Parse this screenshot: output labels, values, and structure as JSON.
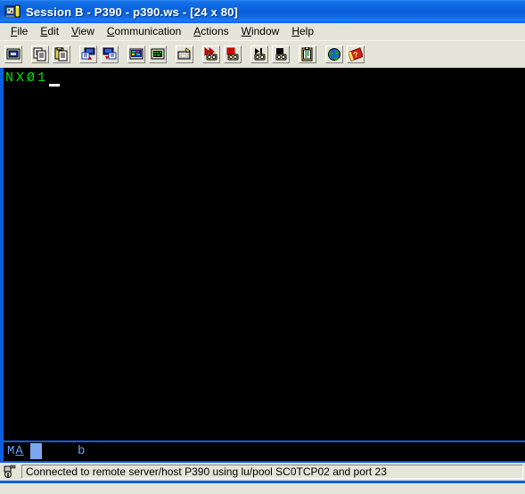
{
  "window": {
    "title": "Session B - P390 - p390.ws - [24 x 80]",
    "icon": "terminal-session-icon",
    "accent_color": "#0a5fe0",
    "titlebar_color": "#0b62dd",
    "chrome_color": "#e4e4d8"
  },
  "menubar": {
    "items": [
      {
        "label": "File",
        "mnemonic": "F"
      },
      {
        "label": "Edit",
        "mnemonic": "E"
      },
      {
        "label": "View",
        "mnemonic": "V"
      },
      {
        "label": "Communication",
        "mnemonic": "C"
      },
      {
        "label": "Actions",
        "mnemonic": "A"
      },
      {
        "label": "Window",
        "mnemonic": "W"
      },
      {
        "label": "Help",
        "mnemonic": "H"
      }
    ]
  },
  "toolbar": {
    "groups": [
      {
        "buttons": [
          {
            "name": "screen-display-button",
            "icon": "monitor-icon",
            "tooltip": "Display"
          }
        ]
      },
      {
        "buttons": [
          {
            "name": "copy-button",
            "icon": "copy-pages-icon",
            "tooltip": "Copy"
          },
          {
            "name": "paste-button",
            "icon": "clipboard-paste-icon",
            "tooltip": "Paste"
          }
        ]
      },
      {
        "buttons": [
          {
            "name": "send-file-button",
            "icon": "send-file-host-icon",
            "tooltip": "Send File to Host"
          },
          {
            "name": "receive-file-button",
            "icon": "receive-file-host-icon",
            "tooltip": "Receive File from Host"
          }
        ]
      },
      {
        "buttons": [
          {
            "name": "color-settings-button",
            "icon": "screen-colors-icon",
            "tooltip": "Colors"
          },
          {
            "name": "font-settings-button",
            "icon": "screen-font-icon",
            "tooltip": "Font"
          }
        ]
      },
      {
        "buttons": [
          {
            "name": "keyboard-settings-button",
            "icon": "keyboard-icon",
            "tooltip": "Keyboard Setup"
          }
        ]
      },
      {
        "buttons": [
          {
            "name": "record-macro-button",
            "icon": "record-macro-icon",
            "tooltip": "Record Macro"
          },
          {
            "name": "stop-recording-button",
            "icon": "stop-record-icon",
            "tooltip": "Stop Recording"
          }
        ]
      },
      {
        "buttons": [
          {
            "name": "play-macro-button",
            "icon": "play-macro-icon",
            "tooltip": "Play Macro"
          },
          {
            "name": "stop-macro-button",
            "icon": "stop-macro-icon",
            "tooltip": "Stop Macro"
          }
        ]
      },
      {
        "buttons": [
          {
            "name": "notepad-button",
            "icon": "clipboard-notes-icon",
            "tooltip": "Notepad"
          }
        ]
      },
      {
        "buttons": [
          {
            "name": "internet-button",
            "icon": "globe-icon",
            "tooltip": "Internet"
          },
          {
            "name": "help-button",
            "icon": "help-book-icon",
            "tooltip": "Help"
          }
        ]
      }
    ]
  },
  "terminal": {
    "rows": 24,
    "cols": 80,
    "background": "#000000",
    "foreground": "#00e000",
    "screen_lines": [
      "NXØ1"
    ],
    "cursor_char": "_",
    "cursor_row": 1,
    "cursor_col": 5
  },
  "oia": {
    "system_indicator": "MA",
    "underlined_char": "A",
    "input_inhibited_block": true,
    "secondary_indicator": "b",
    "color": "#6f9ef5"
  },
  "statusbar": {
    "icon": "connection-plug-icon",
    "message": "Connected to remote server/host P390 using lu/pool SC0TCP02 and port 23"
  }
}
